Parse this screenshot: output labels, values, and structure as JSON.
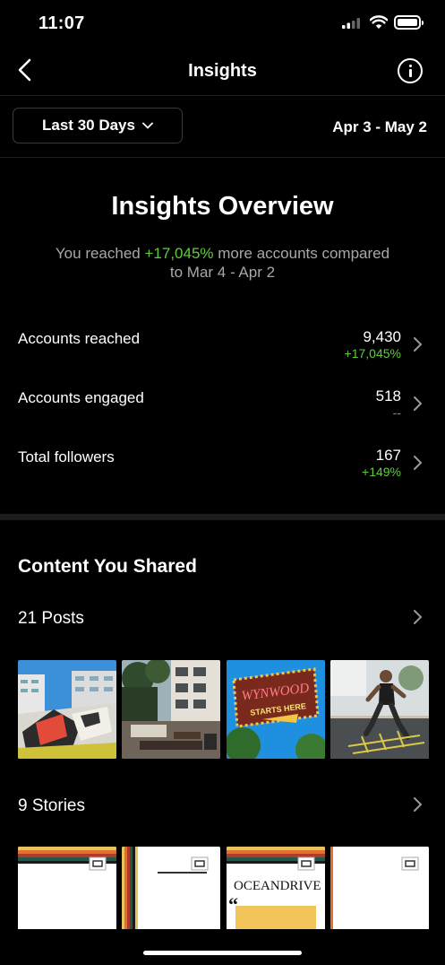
{
  "status_bar": {
    "time": "11:07"
  },
  "header": {
    "title": "Insights"
  },
  "filter": {
    "label": "Last 30 Days",
    "range": "Apr 3 - May 2"
  },
  "overview": {
    "title": "Insights Overview",
    "sub_prefix": "You reached ",
    "sub_highlight": "+17,045%",
    "sub_suffix": " more accounts compared",
    "sub_line2": "to Mar 4 - Apr 2"
  },
  "metrics": [
    {
      "label": "Accounts reached",
      "value": "9,430",
      "delta": "+17,045%"
    },
    {
      "label": "Accounts engaged",
      "value": "518",
      "delta": "--"
    },
    {
      "label": "Total followers",
      "value": "167",
      "delta": "+149%"
    }
  ],
  "content": {
    "title": "Content You Shared",
    "posts_label": "21 Posts",
    "stories_label": "9 Stories",
    "posts": [
      {
        "icon": "mural-building-photo"
      },
      {
        "icon": "courtyard-lounge-photo"
      },
      {
        "icon": "neon-sign-photo"
      },
      {
        "icon": "athlete-agility-ladder-photo"
      }
    ],
    "stories": [
      {
        "icon": "story-thumbnail"
      },
      {
        "icon": "story-thumbnail"
      },
      {
        "icon": "story-thumbnail",
        "brand": "OCEANDRIVE"
      },
      {
        "icon": "story-thumbnail"
      }
    ],
    "neon_text_1": "WYNWOOD",
    "neon_text_2": "STARTS HERE"
  },
  "colors": {
    "background": "#000000",
    "positive": "#5fcc3c",
    "muted": "#a8a8a8"
  }
}
